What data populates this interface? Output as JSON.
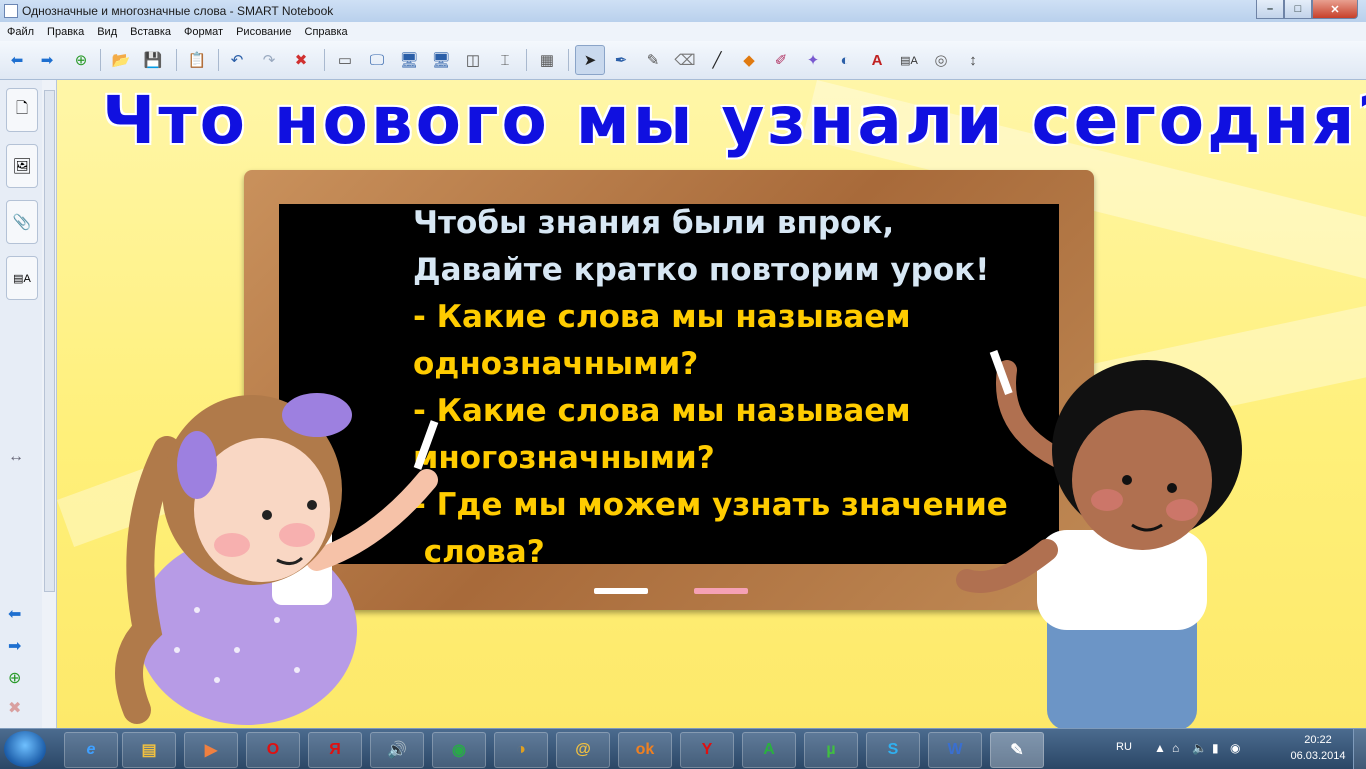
{
  "window": {
    "title": "Однозначные и многозначные слова - SMART Notebook",
    "buttons": {
      "minimize": "–",
      "maximize": "□",
      "close": "✕"
    }
  },
  "menu": [
    "Файл",
    "Правка",
    "Вид",
    "Вставка",
    "Формат",
    "Рисование",
    "Справка"
  ],
  "toolbar_icons": [
    "back-icon",
    "forward-icon",
    "add-page-icon",
    "open-icon",
    "save-icon",
    "paste-icon",
    "undo-icon",
    "redo-icon",
    "delete-icon",
    "screen-shade-icon",
    "display-icon",
    "display-settings-icon",
    "document-camera-icon",
    "capture-icon",
    "table-icon",
    "select-icon",
    "pen-icon",
    "creative-pen-icon",
    "eraser-icon",
    "line-icon",
    "shape-icon",
    "magic-pen-icon",
    "fill-icon",
    "text-icon",
    "properties-icon",
    "cursor-icon",
    "move-toolbar-icon"
  ],
  "slide": {
    "title": "Что нового мы узнали сегодня?",
    "lines": [
      {
        "text": "Чтобы знания были впрок,",
        "color": "white"
      },
      {
        "text": "Давайте кратко повторим урок!",
        "color": "white"
      },
      {
        "text": "- Какие слова мы называем",
        "color": "yellow"
      },
      {
        "text": "однозначными?",
        "color": "yellow"
      },
      {
        "text": "- Какие слова мы называем",
        "color": "yellow"
      },
      {
        "text": "многозначными?",
        "color": "yellow"
      },
      {
        "text": "- Где мы можем узнать значение",
        "color": "yellow"
      },
      {
        "text": " слова?",
        "color": "yellow"
      }
    ],
    "colors": {
      "title": "#1010e0",
      "board": "#000000",
      "white_text": "#d7e7f4",
      "yellow_text": "#ffcc00",
      "background": "#fff07a"
    }
  },
  "tray": {
    "language": "RU",
    "time": "20:22",
    "date": "06.03.2014"
  },
  "taskbar_apps": [
    "ie",
    "explorer",
    "media-player",
    "opera",
    "yandex",
    "sound",
    "chrome",
    "smart-notebook",
    "mail",
    "odnoklassniki",
    "yandex-browser",
    "acrobat",
    "utorrent",
    "skype",
    "word",
    "notebook-active"
  ]
}
